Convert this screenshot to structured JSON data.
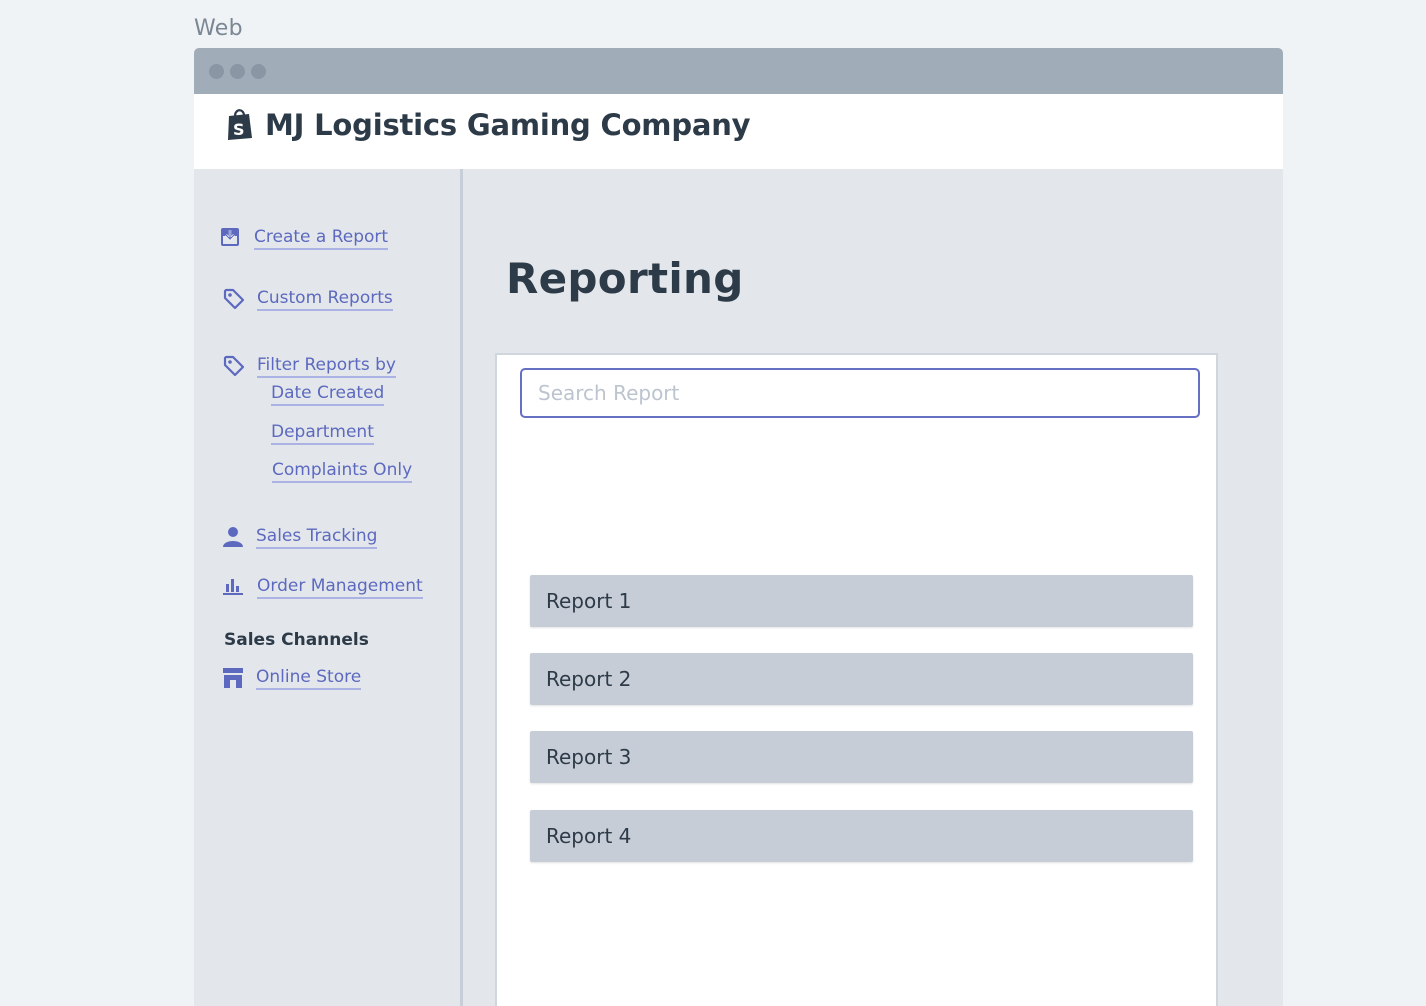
{
  "frame": {
    "label": "Web"
  },
  "app": {
    "company_name": "MJ Logistics Gaming Company",
    "logo_icon": "shopping-bag-icon"
  },
  "sidebar": {
    "items": [
      {
        "label": "Create a Report",
        "icon": "download-box-icon"
      },
      {
        "label": "Custom Reports",
        "icon": "tag-icon"
      },
      {
        "label": "Filter Reports by",
        "icon": "tag-icon",
        "subitems": [
          "Date Created",
          "Department",
          "Complaints Only"
        ]
      },
      {
        "label": "Sales Tracking",
        "icon": "person-icon"
      },
      {
        "label": "Order Management",
        "icon": "bar-chart-icon"
      }
    ],
    "section_heading": "Sales Channels",
    "channels": [
      {
        "label": "Online Store",
        "icon": "store-icon"
      }
    ]
  },
  "main": {
    "title": "Reporting",
    "search": {
      "placeholder": "Search Report",
      "value": ""
    },
    "reports": [
      "Report 1",
      "Report 2",
      "Report 3",
      "Report 4"
    ]
  },
  "colors": {
    "accent": "#5c69bf",
    "heading": "#2d3a48",
    "background": "#e3e7ec",
    "row": "#c6cdd7"
  }
}
